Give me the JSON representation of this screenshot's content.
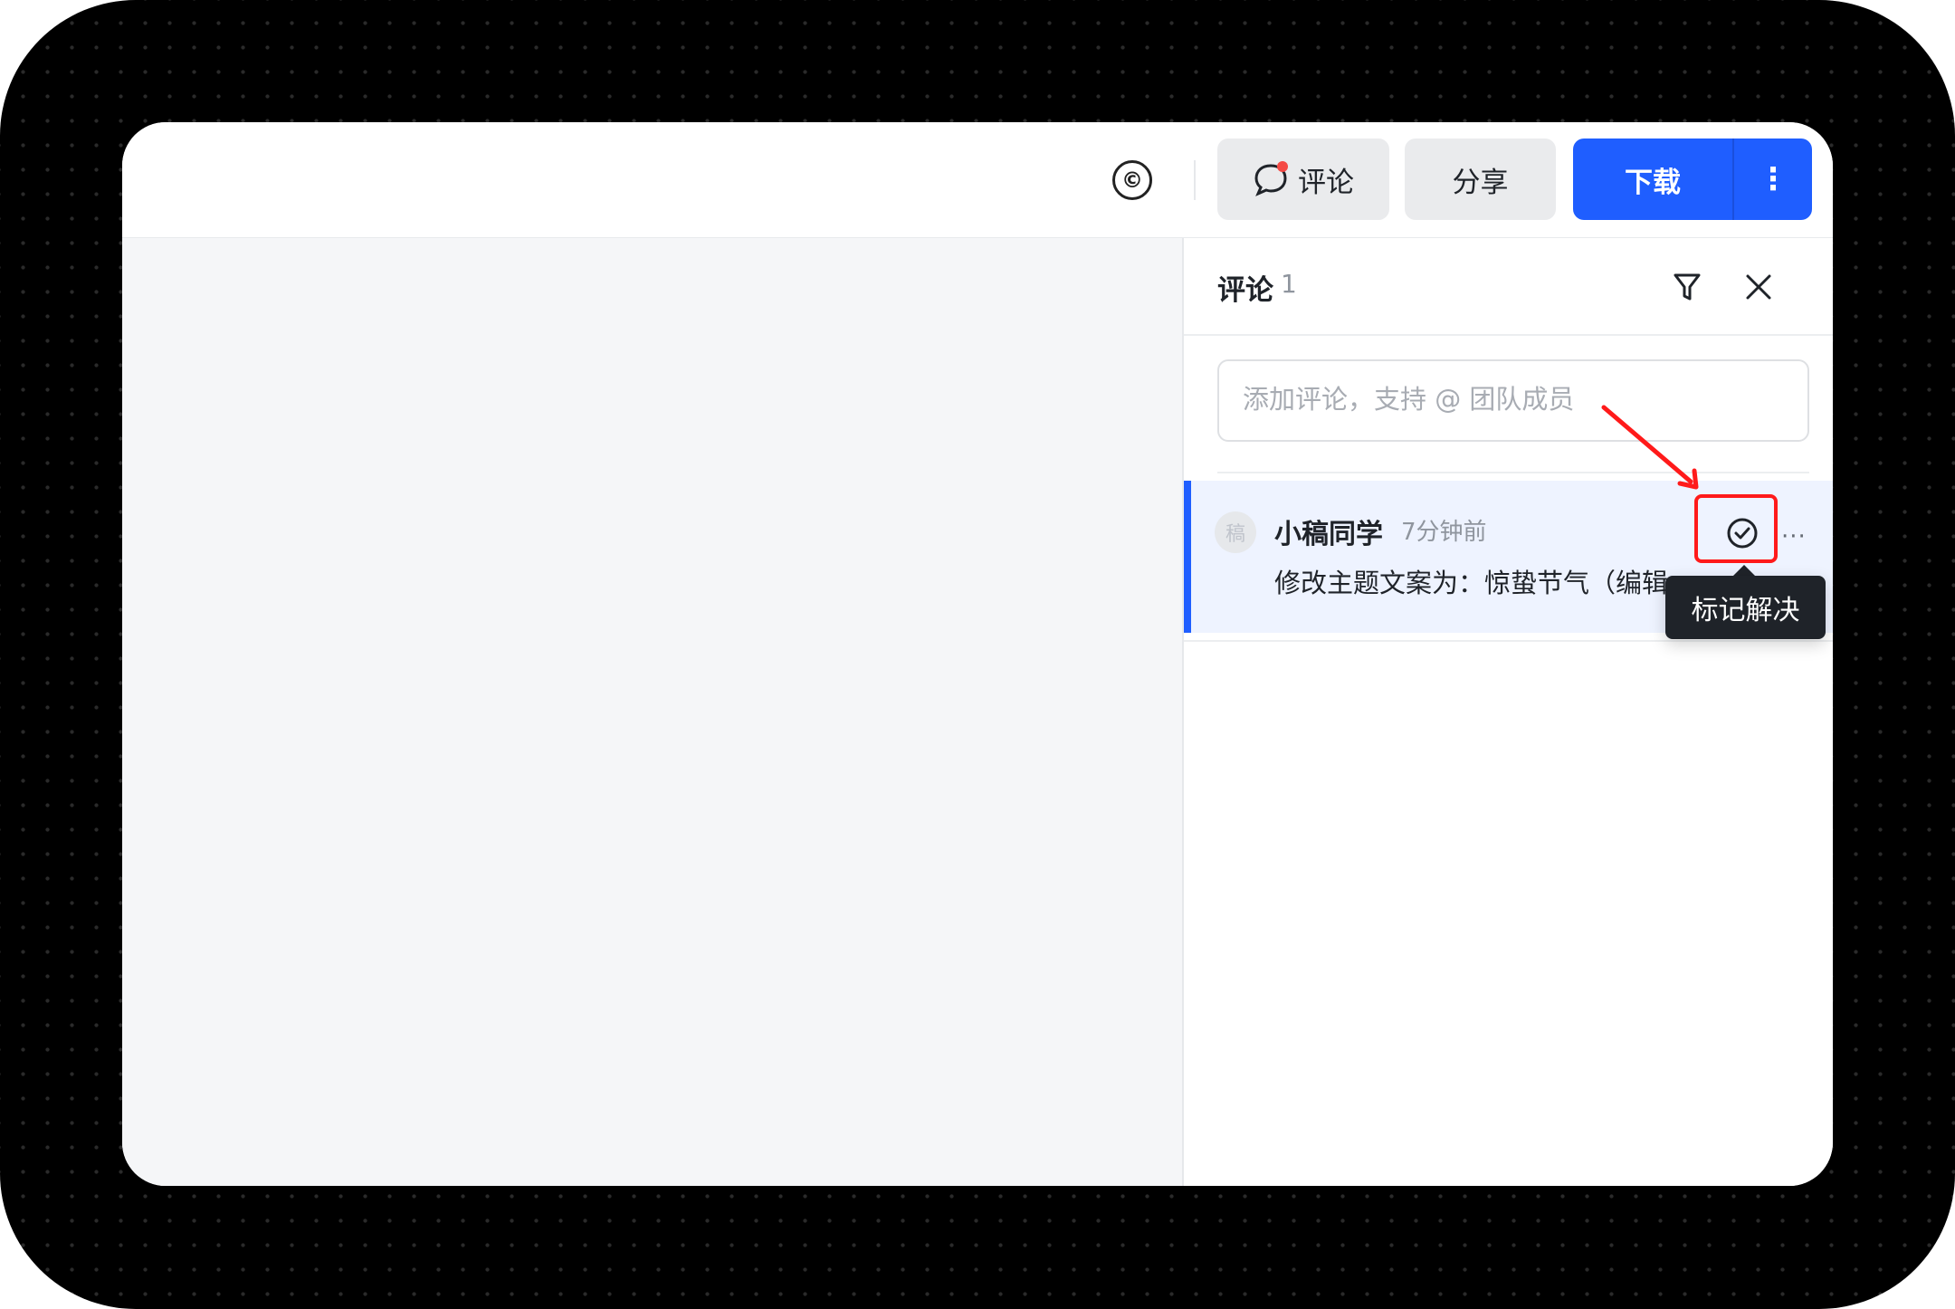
{
  "toolbar": {
    "copyright_symbol": "©",
    "comment_label": "评论",
    "share_label": "分享",
    "download_label": "下载",
    "more_label": "⋮"
  },
  "panel": {
    "title": "评论",
    "count": "1",
    "input_placeholder": "添加评论，支持 @ 团队成员"
  },
  "comment": {
    "avatar_text": "稿",
    "author": "小稿同学",
    "time": "7分钟前",
    "body": "修改主题文案为：惊蛰节气（编辑"
  },
  "tooltip": {
    "text": "标记解决"
  },
  "colors": {
    "primary": "#1f5eff",
    "highlight_red": "#ff1a1a",
    "notification_dot": "#f54a45"
  }
}
